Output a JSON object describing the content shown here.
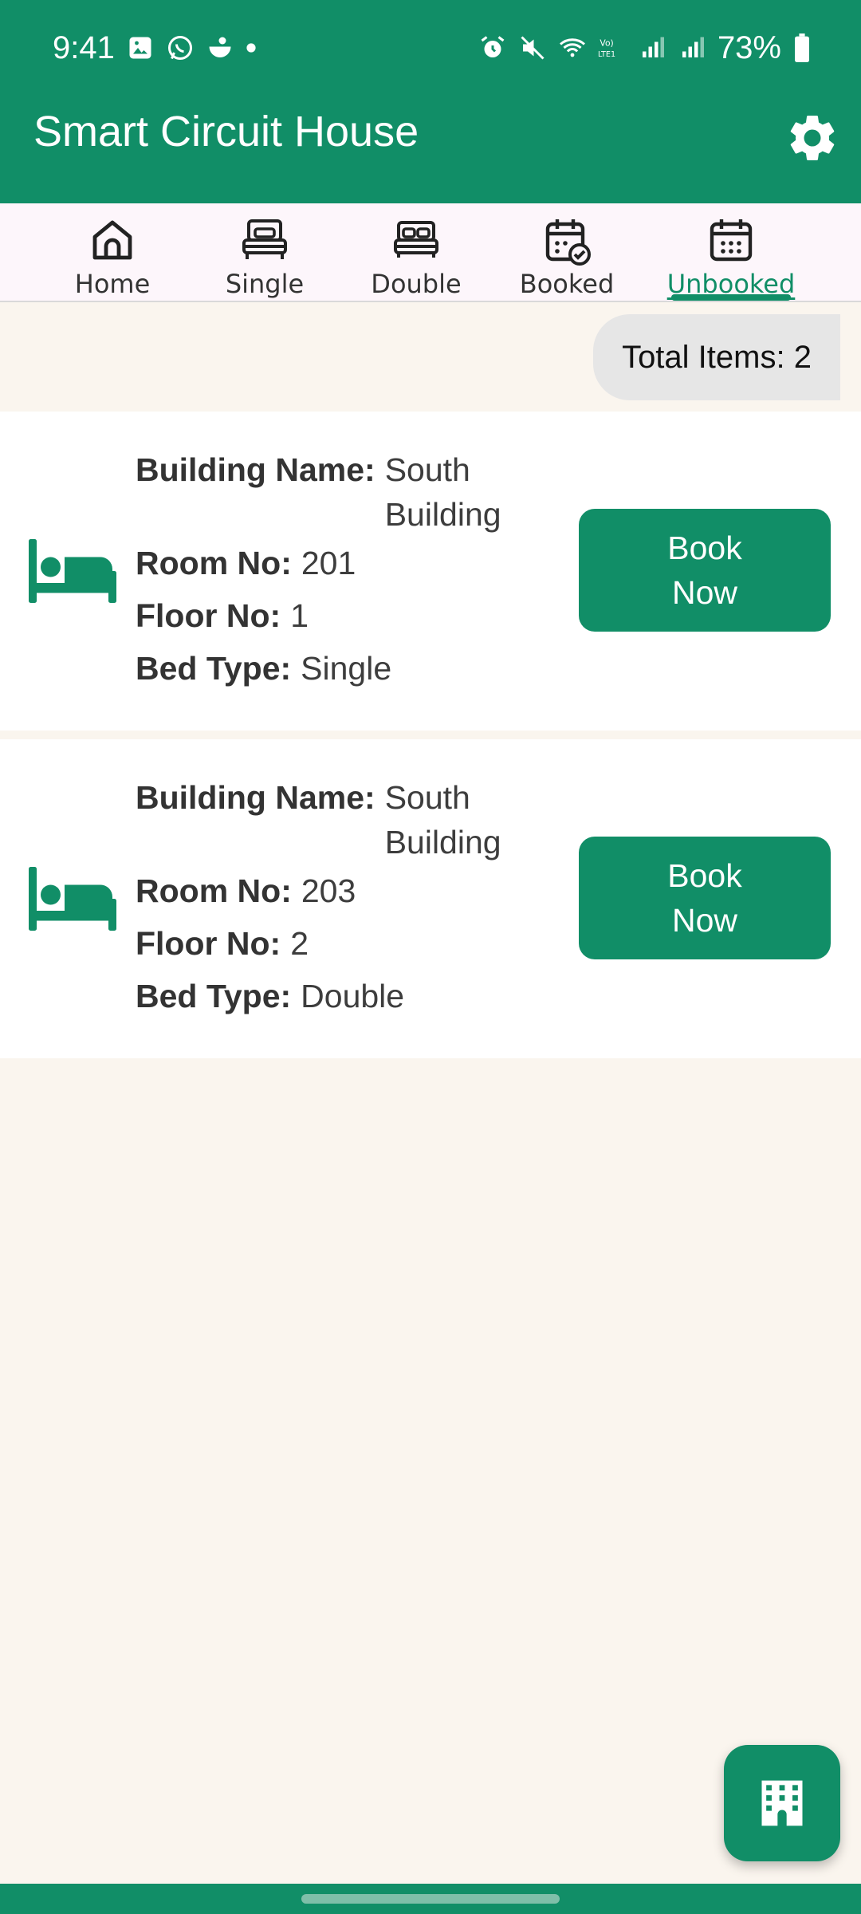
{
  "status_bar": {
    "time": "9:41",
    "battery": "73%",
    "left_icons": [
      "gallery-icon",
      "whatsapp-icon",
      "app-icon",
      "dot-icon"
    ],
    "right_icons": [
      "alarm-icon",
      "mute-icon",
      "wifi-icon",
      "volte-icon",
      "signal-icon",
      "signal-icon",
      "battery-icon"
    ]
  },
  "appbar": {
    "title": "Smart Circuit House",
    "settings_icon": "gear-icon",
    "color": "#118e67"
  },
  "tabs": [
    {
      "label": "Home",
      "icon": "home-icon",
      "active": false
    },
    {
      "label": "Single",
      "icon": "single-bed-icon",
      "active": false
    },
    {
      "label": "Double",
      "icon": "double-bed-icon",
      "active": false
    },
    {
      "label": "Booked",
      "icon": "calendar-check-icon",
      "active": false
    },
    {
      "label": "Unbooked",
      "icon": "calendar-icon",
      "active": true
    }
  ],
  "total": {
    "text": "Total Items: 2"
  },
  "rooms": [
    {
      "building_label": "Building Name:",
      "building_value": "South Building",
      "room_label": "Room No:",
      "room_value": "201",
      "floor_label": "Floor No:",
      "floor_value": "1",
      "bed_label": "Bed Type:",
      "bed_value": "Single",
      "button": "Book Now"
    },
    {
      "building_label": "Building Name:",
      "building_value": "South Building",
      "room_label": "Room No:",
      "room_value": "203",
      "floor_label": "Floor No:",
      "floor_value": "2",
      "bed_label": "Bed Type:",
      "bed_value": "Double",
      "button": "Book Now"
    }
  ],
  "fab": {
    "icon": "building-icon"
  },
  "colors": {
    "accent": "#118e67",
    "background": "#faf5ee",
    "pill": "#e6e6e6"
  }
}
